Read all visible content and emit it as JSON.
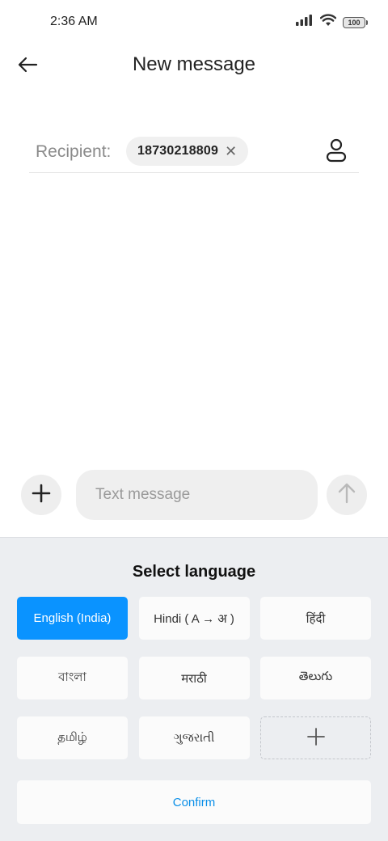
{
  "status_bar": {
    "time": "2:36 AM",
    "battery": "100"
  },
  "header": {
    "title": "New message",
    "back_icon": "arrow-left-icon"
  },
  "recipient": {
    "label": "Recipient:",
    "chip_value": "18730218809",
    "chip_remove_glyph": "✕",
    "contact_icon": "person-icon"
  },
  "compose": {
    "placeholder": "Text message",
    "value": "",
    "attach_icon": "plus-icon",
    "send_icon": "arrow-up-icon"
  },
  "language_panel": {
    "title": "Select language",
    "languages": [
      {
        "label": "English (India)",
        "selected": true
      },
      {
        "label": "Hindi ( A → अ )",
        "selected": false
      },
      {
        "label": "हिंदी",
        "selected": false
      },
      {
        "label": "বাংলা",
        "selected": false
      },
      {
        "label": "मराठी",
        "selected": false
      },
      {
        "label": "తెలుగు",
        "selected": false
      },
      {
        "label": "தமிழ்",
        "selected": false
      },
      {
        "label": "ગુજરાતી",
        "selected": false
      }
    ],
    "add_icon": "plus-icon",
    "confirm_label": "Confirm"
  },
  "colors": {
    "accent": "#0a93ff",
    "panel_background": "#eceef1",
    "confirm_text": "#0a8fe8"
  }
}
